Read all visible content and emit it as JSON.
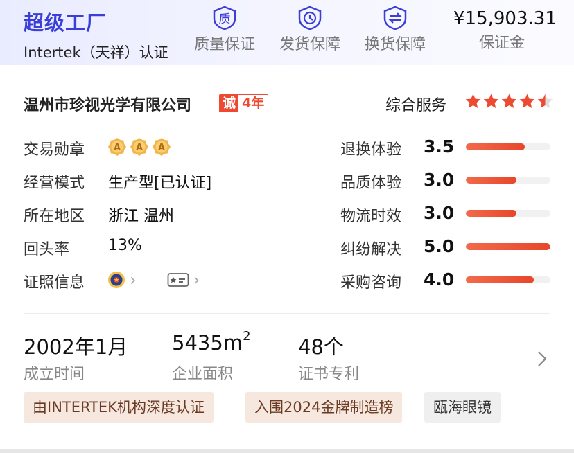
{
  "header": {
    "title": "超级工厂",
    "subtitle": "Intertek（天祥）认证",
    "guarantees": [
      {
        "label": "质量保证",
        "icon": "quality-shield-icon"
      },
      {
        "label": "发货保障",
        "icon": "shipping-clock-icon"
      },
      {
        "label": "换货保障",
        "icon": "exchange-arrows-icon"
      }
    ],
    "deposit": {
      "amount": "¥15,903.31",
      "label": "保证金"
    },
    "accent_color": "#3b3fd8"
  },
  "company": {
    "name": "温州市珍视光学有限公司",
    "integrity_badge": {
      "prefix": "诚",
      "years": "4年"
    },
    "service_label": "综合服务",
    "service_stars": 4.5
  },
  "info": {
    "medals_label": "交易勋章",
    "medal_letter": "A",
    "medal_count": 3,
    "mode_label": "经营模式",
    "mode_value": "生产型[已认证]",
    "region_label": "所在地区",
    "region_value": "浙江 温州",
    "repeat_label": "回头率",
    "repeat_value": "13%",
    "cert_label": "证照信息",
    "cert_icons": [
      "police-emblem-icon",
      "id-card-icon"
    ]
  },
  "ratings": [
    {
      "label": "退换体验",
      "score": "3.5",
      "fill": 0.7
    },
    {
      "label": "品质体验",
      "score": "3.0",
      "fill": 0.6
    },
    {
      "label": "物流时效",
      "score": "3.0",
      "fill": 0.6
    },
    {
      "label": "纠纷解决",
      "score": "5.0",
      "fill": 1.0
    },
    {
      "label": "采购咨询",
      "score": "4.0",
      "fill": 0.8
    }
  ],
  "stats": {
    "founded_value": "2002年1月",
    "founded_label": "成立时间",
    "area_value": "5435m",
    "area_sup": "2",
    "area_label": "企业面积",
    "patents_value": "48个",
    "patents_label": "证书专利"
  },
  "tags": [
    "由INTERTEK机构深度认证",
    "入围2024金牌制造榜",
    "瓯海眼镜"
  ],
  "colors": {
    "rating_fill": "#e8462a",
    "star": "#ee4a32",
    "medal": "#f3b54a",
    "tag_highlight_bg": "#f7e8df"
  }
}
